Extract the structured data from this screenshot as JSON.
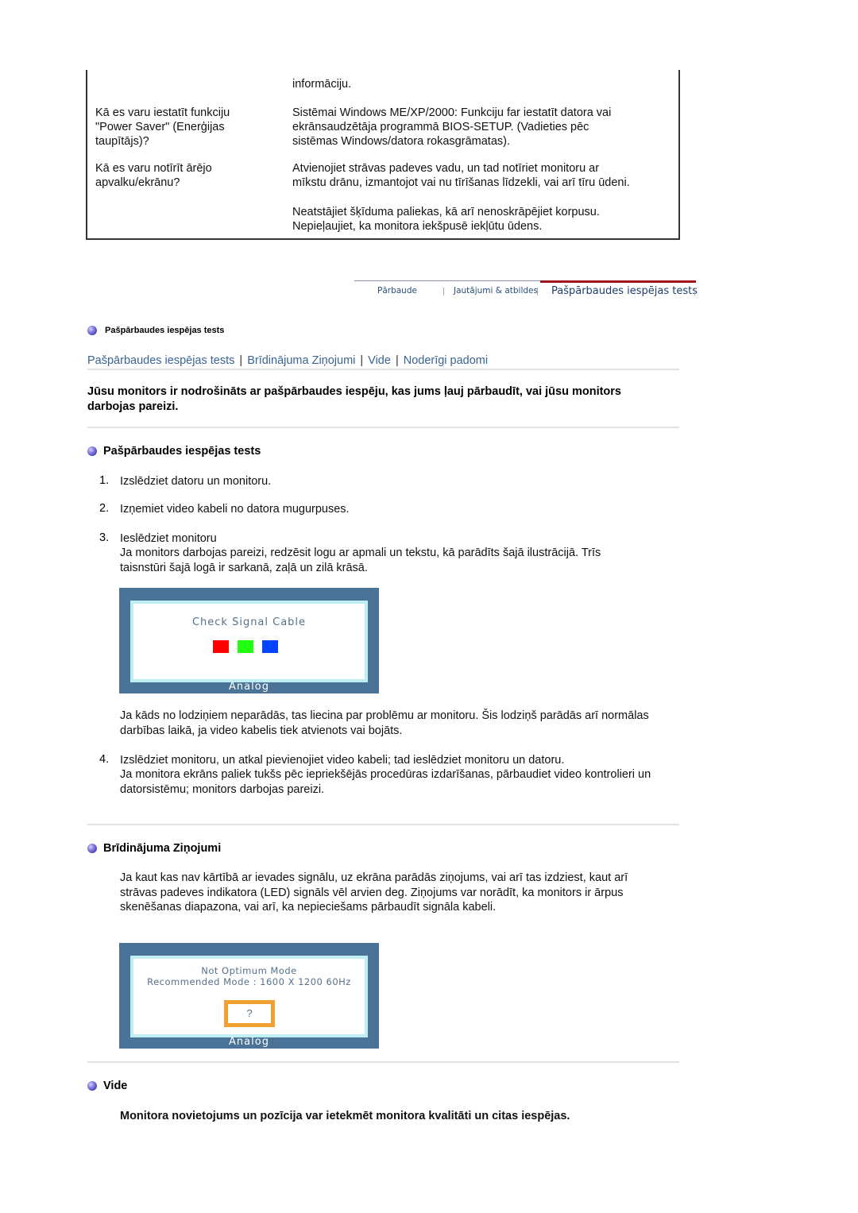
{
  "faq": {
    "rows": [
      {
        "question": "",
        "answer": "informāciju."
      },
      {
        "question": "Kā es varu iestatīt funkciju \"Power Saver\" (Enerģijas taupītājs)?",
        "answer": "Sistēmai Windows ME/XP/2000: Funkciju far iestatīt datora vai ekrānsaudzētāja programmā BIOS-SETUP. (Vadieties pēc sistēmas Windows/datora rokasgrāmatas)."
      },
      {
        "question": "Kā es varu notīrīt ārējo apvalku/ekrānu?",
        "answer": "Atvienojiet strāvas padeves vadu, un tad notīriet monitoru ar mīkstu drānu, izmantojot vai nu tīrīšanas līdzekli, vai arī tīru ūdeni."
      },
      {
        "question": "",
        "answer": "Neatstājiet šķīduma paliekas, kā arī nenoskrāpējiet korpusu. Nepieļaujiet, ka monitora iekšpusē iekļūtu ūdens."
      }
    ],
    "q1_lines": [
      "Kā es varu iestatīt funkciju",
      "\"Power Saver\" (Enerģijas",
      "taupītājs)?"
    ],
    "a1_lines": [
      "Sistēmai Windows ME/XP/2000: Funkciju far iestatīt datora vai",
      "ekrānsaudzētāja programmā BIOS-SETUP. (Vadieties pēc",
      "sistēmas Windows/datora rokasgrāmatas)."
    ],
    "q2_lines": [
      "Kā es varu notīrīt ārējo",
      "apvalku/ekrānu?"
    ],
    "a2_lines": [
      "Atvienojiet strāvas padeves vadu, un tad notīriet monitoru ar",
      "mīkstu drānu, izmantojot vai nu tīrīšanas līdzekli, vai arī tīru ūdeni."
    ],
    "a3_lines": [
      "Neatstājiet šķīduma paliekas, kā arī nenoskrāpējiet korpusu.",
      "Nepieļaujiet, ka monitora iekšpusē iekļūtu ūdens."
    ]
  },
  "topnav": {
    "tabs": [
      {
        "label": "Pārbaude",
        "active": false
      },
      {
        "label": "Jautājumi & atbildes",
        "active": false
      },
      {
        "label": "Pašpārbaudes iespējas tests",
        "active": true
      }
    ],
    "active_color": "#a0141e"
  },
  "crumb": "Pašpārbaudes iespējas tests",
  "linkbar": [
    "Pašpārbaudes iespējas tests",
    "Brīdinājuma Ziņojumi",
    "Vide",
    "Noderīgi padomi"
  ],
  "lead": "Jūsu monitors ir nodrošināts ar pašpārbaudes iespēju, kas jums ļauj pārbaudīt, vai jūsu monitors darbojas pareizi.",
  "section1": {
    "title": "Pašpārbaudes iespējas tests",
    "steps": [
      {
        "num": "1.",
        "text": "Izslēdziet datoru un monitoru."
      },
      {
        "num": "2.",
        "text": "Izņemiet video kabeli no datora mugurpuses."
      },
      {
        "num": "3.",
        "text": "Ieslēdziet monitoru",
        "detail": "Ja monitors darbojas pareizi, redzēsit logu ar apmali un tekstu, kā parādīts šajā ilustrācijā. Trīs taisnstūri šajā logā ir sarkanā, zaļā un zilā krāsā."
      },
      {
        "num": "4.",
        "text": "Izslēdziet monitoru, un atkal pievienojiet video kabeli; tad ieslēdziet monitoru un datoru.",
        "detail": "Ja monitora ekrāns paliek tukšs pēc iepriekšējās procedūras izdarīšanas, pārbaudiet video kontrolieri un datorsistēmu; monitors darbojas pareizi."
      }
    ],
    "after_image": "Ja kāds no lodziņiem neparādās, tas liecina par problēmu ar monitoru. Šis lodziņš parādās arī normālas darbības laikā, ja video kabelis tiek atvienots vai bojāts.",
    "screen": {
      "message": "Check Signal Cable",
      "footer": "Analog",
      "squares": [
        "#ff0000",
        "#22ff11",
        "#0044ff"
      ]
    }
  },
  "section2": {
    "title": "Brīdinājuma Ziņojumi",
    "text": "Ja kaut kas nav kārtībā ar ievades signālu, uz ekrāna parādās ziņojums, vai arī tas izdziest, kaut arī strāvas padeves indikatora (LED) signāls vēl arvien deg. Ziņojums var norādīt, ka monitors ir ārpus skenēšanas diapazona, vai arī, ka nepieciešams pārbaudīt signāla kabeli.",
    "screen": {
      "line1": "Not Optimum Mode",
      "line2": "Recommended Mode : 1600 X 1200  60Hz",
      "button": "?",
      "footer": "Analog"
    }
  },
  "section3": {
    "title": "Vide",
    "text": "Monitora novietojums un pozīcija var ietekmēt monitora kvalitāti un citas iespējas."
  }
}
